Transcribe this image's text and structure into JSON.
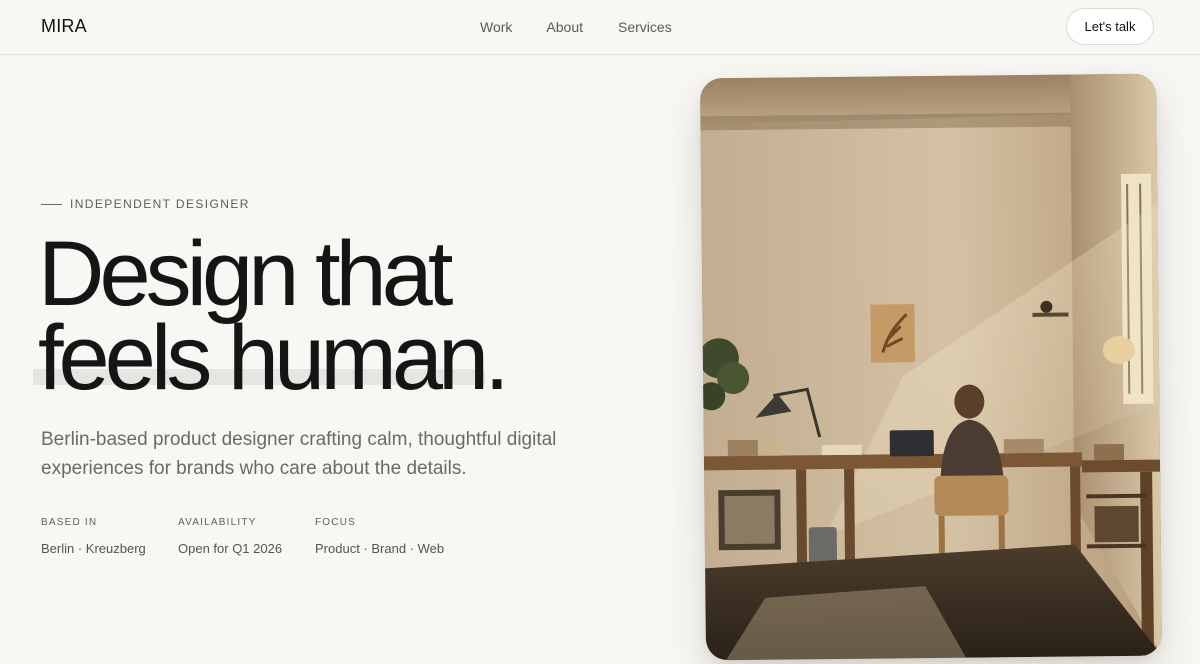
{
  "header": {
    "logo": "MIRA",
    "nav": [
      "Work",
      "About",
      "Services"
    ],
    "cta_label": "Let's talk"
  },
  "hero": {
    "eyebrow": "INDEPENDENT DESIGNER",
    "headline_line1": "Design that",
    "headline_line2": "feels human.",
    "lede_line1": "Berlin-based product designer crafting calm, thoughtful digital",
    "lede_line2": "experiences for brands who care about the details.",
    "facts": [
      {
        "label": "BASED IN",
        "value": "Berlin · Kreuzberg"
      },
      {
        "label": "AVAILABILITY",
        "value": "Open for Q1 2026"
      },
      {
        "label": "FOCUS",
        "value": "Product · Brand · Web"
      }
    ]
  },
  "colors": {
    "background": "#f8f7f4",
    "text": "#151515",
    "muted": "#6a6a66"
  }
}
